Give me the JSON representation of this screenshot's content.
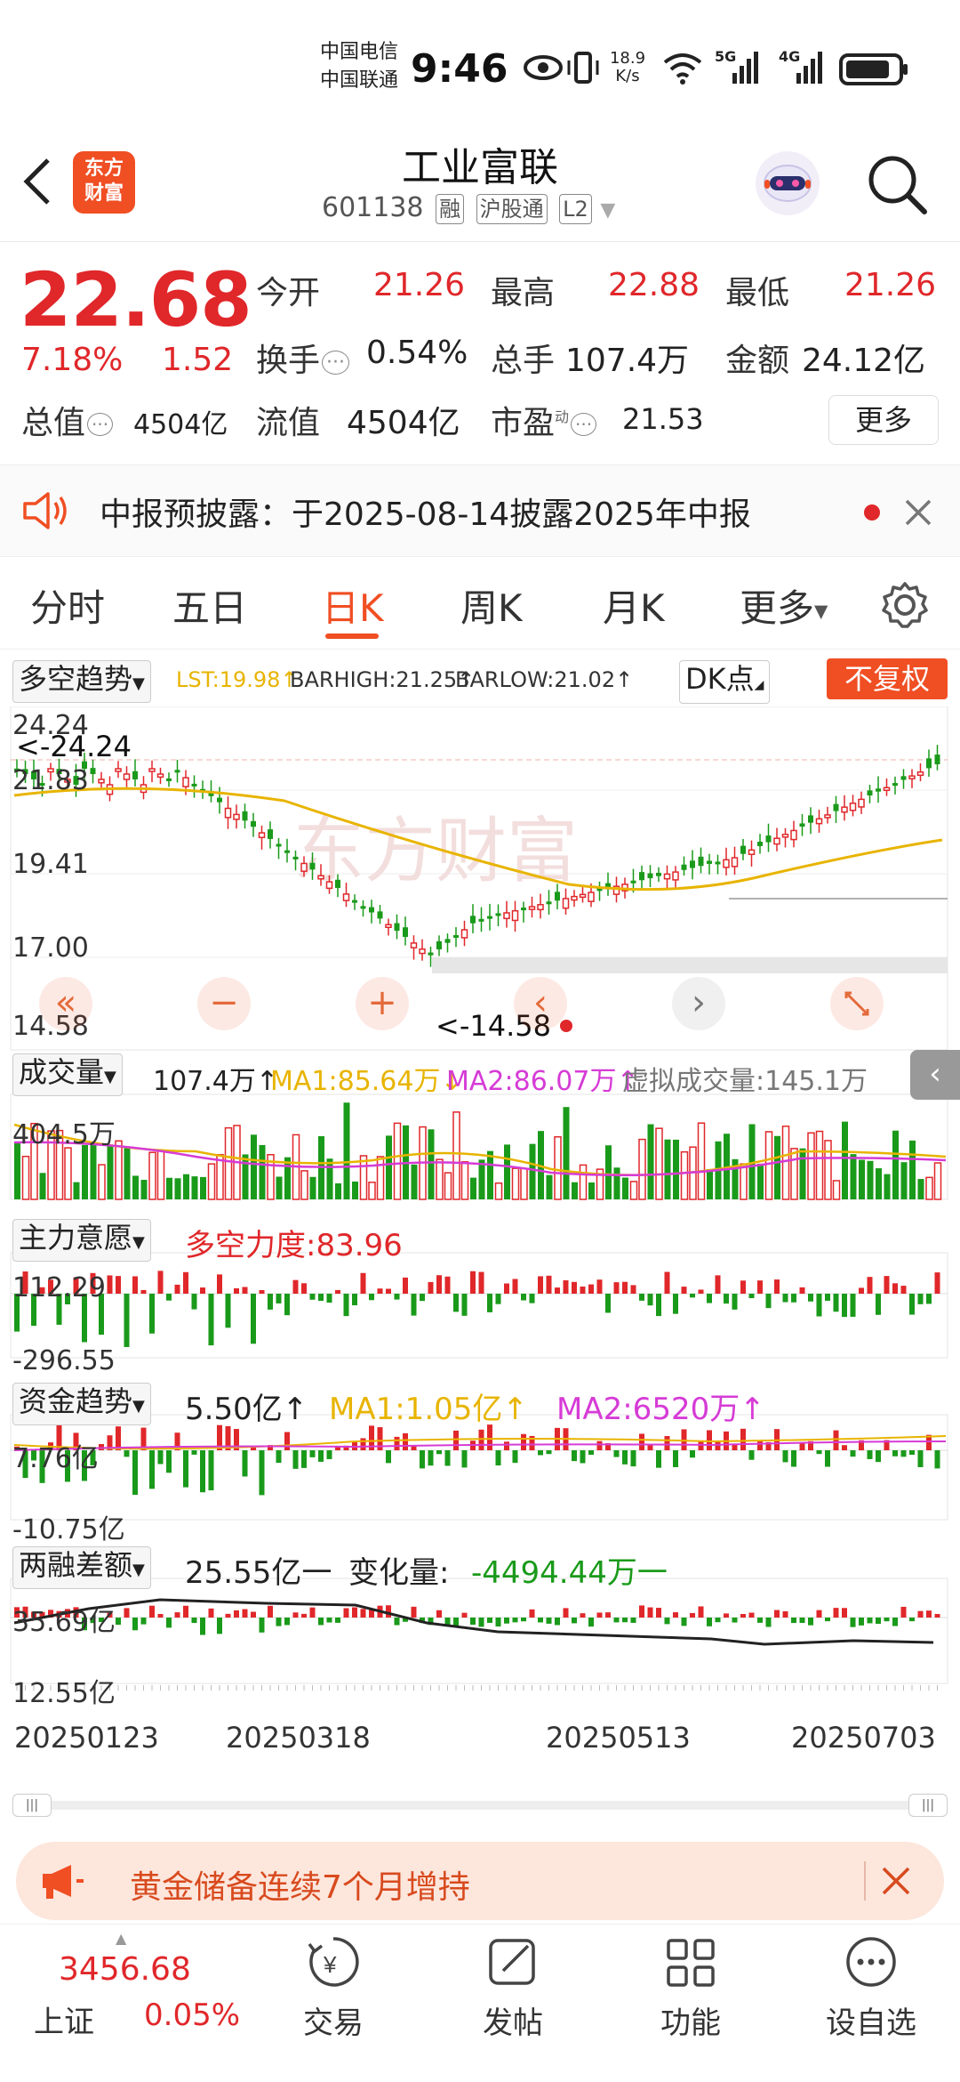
{
  "status_bar": {
    "carrier_1": "中国电信",
    "carrier_2": "中国联通",
    "time": "9:46",
    "net_speed_top": "18.9",
    "net_speed_bottom": "K/s",
    "signal_1": "5G",
    "signal_2": "4G"
  },
  "header": {
    "logo_line1": "东方",
    "logo_line2": "财富",
    "title": "工业富联",
    "code": "601138",
    "tags": [
      "融",
      "沪股通",
      "L2"
    ]
  },
  "quote": {
    "price": "22.68",
    "change_pct": "7.18%",
    "change_amt": "1.52",
    "open_label": "今开",
    "open": "21.26",
    "high_label": "最高",
    "high": "22.88",
    "low_label": "最低",
    "low": "21.26",
    "turnover_label": "换手",
    "turnover": "0.54%",
    "volume_label": "总手",
    "volume": "107.4万",
    "amount_label": "金额",
    "amount": "24.12亿",
    "mktcap_label": "总值",
    "mktcap": "4504亿",
    "float_label": "流值",
    "float": "4504亿",
    "pe_label": "市盈",
    "pe_sup": "动",
    "pe": "21.53",
    "more_button": "更多"
  },
  "notice": {
    "text": "中报预披露：于2025-08-14披露2025年中报"
  },
  "tabs": [
    "分时",
    "五日",
    "日K",
    "周K",
    "月K",
    "更多"
  ],
  "active_tab": 2,
  "kline": {
    "indicator_select": "多空趋势",
    "lst": "LST:19.98↑",
    "barhigh": "BARHIGH:21.25↑",
    "barlow": "BARLOW:21.02↑",
    "dk_button": "DK点",
    "adjust_button": "不复权",
    "y_labels": [
      "24.24",
      "21.83",
      "19.41",
      "17.00",
      "14.58"
    ],
    "max_marker": "<-24.24",
    "min_marker": "<-14.58",
    "watermark": "东方财富"
  },
  "volume": {
    "select": "成交量",
    "value": "107.4万↑",
    "ma1": "MA1:85.64万↓",
    "ma2": "MA2:86.07万↑",
    "virtual": "虚拟成交量:145.1万",
    "top_label": "404.5万"
  },
  "main_force": {
    "select": "主力意愿",
    "value": "多空力度:83.96",
    "top": "112.29",
    "bottom": "-296.55"
  },
  "fund_trend": {
    "select": "资金趋势",
    "value": "5.50亿↑",
    "ma1": "MA1:1.05亿↑",
    "ma2": "MA2:6520万↑",
    "top": "7.76亿",
    "bottom": "-10.75亿"
  },
  "margin": {
    "select": "两融差额",
    "value": "25.55亿一",
    "change_label": "变化量:",
    "change": "-4494.44万一",
    "top": "35.69亿",
    "bottom": "12.55亿"
  },
  "dates": [
    "20250123",
    "20250318",
    "20250513",
    "20250703"
  ],
  "banner": {
    "text": "黄金储备连续7个月增持"
  },
  "bottom_nav": {
    "index_value": "3456.68",
    "index_name": "上证",
    "index_change": "0.05%",
    "items": [
      "交易",
      "发帖",
      "功能",
      "设自选"
    ]
  },
  "colors": {
    "up": "#e0272a",
    "down": "#1a9a1a",
    "brand": "#f04e23",
    "ma_gold": "#e8b400",
    "ma_magenta": "#d63bd6"
  }
}
